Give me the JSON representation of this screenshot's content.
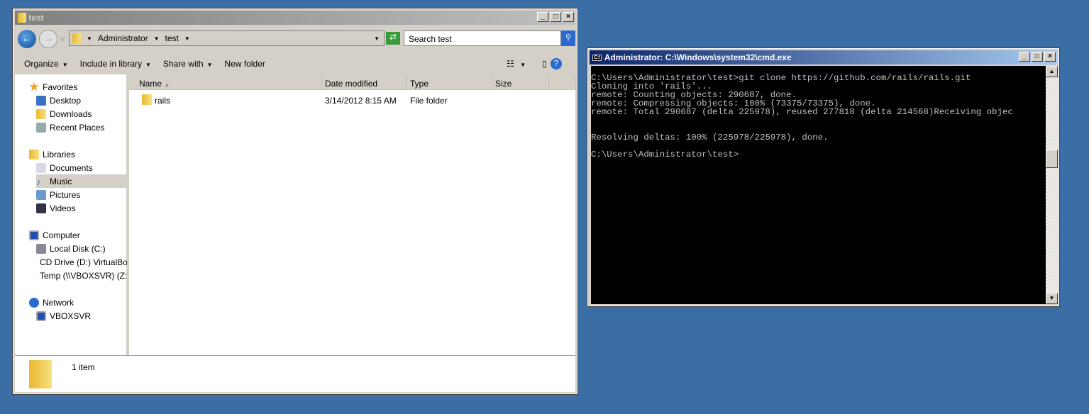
{
  "explorer": {
    "title": "test",
    "breadcrumb": [
      "Administrator",
      "test"
    ],
    "search_placeholder": "Search test",
    "toolbar": {
      "organize": "Organize",
      "include": "Include in library",
      "share": "Share with",
      "new_folder": "New folder"
    },
    "nav": {
      "favorites": "Favorites",
      "desktop": "Desktop",
      "downloads": "Downloads",
      "recent": "Recent Places",
      "libraries": "Libraries",
      "documents": "Documents",
      "music": "Music",
      "pictures": "Pictures",
      "videos": "Videos",
      "computer": "Computer",
      "local_disk": "Local Disk (C:)",
      "cd_drive": "CD Drive (D:) VirtualBox Guest Additions",
      "temp": "Temp (\\\\VBOXSVR) (Z:)",
      "network": "Network",
      "vboxsvr": "VBOXSVR"
    },
    "columns": {
      "name": "Name",
      "date": "Date modified",
      "type": "Type",
      "size": "Size"
    },
    "files": [
      {
        "name": "rails",
        "date": "3/14/2012 8:15 AM",
        "type": "File folder",
        "size": ""
      }
    ],
    "status": "1 item"
  },
  "cmd": {
    "title": "Administrator: C:\\Windows\\system32\\cmd.exe",
    "output": "C:\\Users\\Administrator\\test>git clone https://github.com/rails/rails.git\nCloning into 'rails'...\nremote: Counting objects: 290687, done.\nremote: Compressing objects: 100% (73375/73375), done.\nremote: Total 290687 (delta 225978), reused 277818 (delta 214568)Receiving objec\n\n\nResolving deltas: 100% (225978/225978), done.\n\nC:\\Users\\Administrator\\test>"
  }
}
